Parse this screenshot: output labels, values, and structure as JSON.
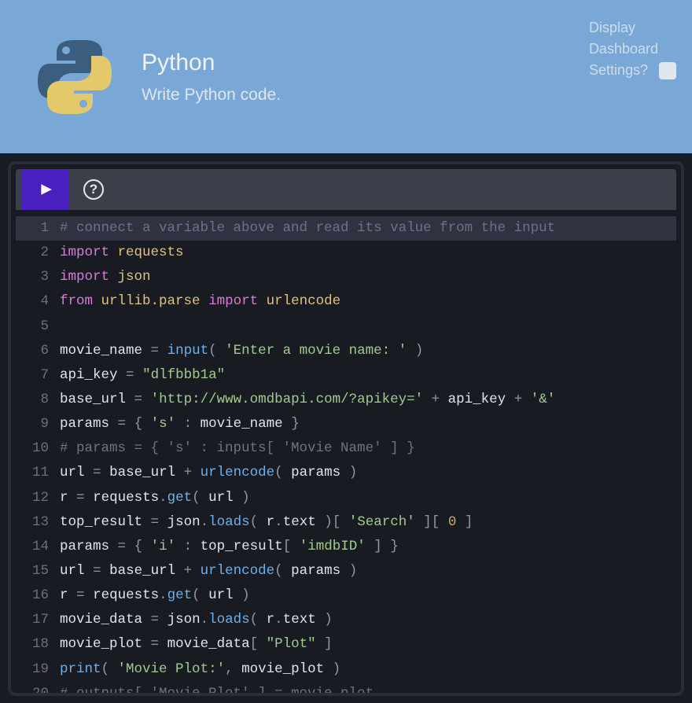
{
  "header": {
    "title": "Python",
    "subtitle": "Write Python code."
  },
  "settings": {
    "line1": "Display",
    "line2": "Dashboard",
    "line3": "Settings?"
  },
  "toolbar": {
    "run_label": "Run",
    "help_label": "?"
  },
  "code": {
    "lines": [
      {
        "n": 1,
        "highlight": true,
        "tokens": [
          {
            "t": "# connect a variable above and read its value from the input",
            "c": "comment"
          }
        ]
      },
      {
        "n": 2,
        "tokens": [
          {
            "t": "import",
            "c": "keyword"
          },
          {
            "t": " "
          },
          {
            "t": "requests",
            "c": "module"
          }
        ]
      },
      {
        "n": 3,
        "tokens": [
          {
            "t": "import",
            "c": "keyword"
          },
          {
            "t": " "
          },
          {
            "t": "json",
            "c": "module"
          }
        ]
      },
      {
        "n": 4,
        "tokens": [
          {
            "t": "from",
            "c": "keyword"
          },
          {
            "t": " "
          },
          {
            "t": "urllib.parse",
            "c": "module"
          },
          {
            "t": " "
          },
          {
            "t": "import",
            "c": "keyword"
          },
          {
            "t": " "
          },
          {
            "t": "urlencode",
            "c": "module"
          }
        ]
      },
      {
        "n": 5,
        "tokens": []
      },
      {
        "n": 6,
        "tokens": [
          {
            "t": "movie_name",
            "c": "var"
          },
          {
            "t": " "
          },
          {
            "t": "=",
            "c": "op"
          },
          {
            "t": " "
          },
          {
            "t": "input",
            "c": "builtin"
          },
          {
            "t": "(",
            "c": "punct"
          },
          {
            "t": " "
          },
          {
            "t": "'Enter a movie name: '",
            "c": "string"
          },
          {
            "t": " "
          },
          {
            "t": ")",
            "c": "punct"
          }
        ]
      },
      {
        "n": 7,
        "tokens": [
          {
            "t": "api_key",
            "c": "var"
          },
          {
            "t": " "
          },
          {
            "t": "=",
            "c": "op"
          },
          {
            "t": " "
          },
          {
            "t": "\"dlfbbb1a\"",
            "c": "string"
          }
        ]
      },
      {
        "n": 8,
        "tokens": [
          {
            "t": "base_url",
            "c": "var"
          },
          {
            "t": " "
          },
          {
            "t": "=",
            "c": "op"
          },
          {
            "t": " "
          },
          {
            "t": "'http://www.omdbapi.com/?apikey='",
            "c": "string"
          },
          {
            "t": " "
          },
          {
            "t": "+",
            "c": "op"
          },
          {
            "t": " "
          },
          {
            "t": "api_key",
            "c": "var"
          },
          {
            "t": " "
          },
          {
            "t": "+",
            "c": "op"
          },
          {
            "t": " "
          },
          {
            "t": "'&'",
            "c": "string"
          }
        ]
      },
      {
        "n": 9,
        "tokens": [
          {
            "t": "params",
            "c": "var"
          },
          {
            "t": " "
          },
          {
            "t": "=",
            "c": "op"
          },
          {
            "t": " "
          },
          {
            "t": "{",
            "c": "punct"
          },
          {
            "t": " "
          },
          {
            "t": "'s'",
            "c": "string"
          },
          {
            "t": " "
          },
          {
            "t": ":",
            "c": "punct"
          },
          {
            "t": " "
          },
          {
            "t": "movie_name",
            "c": "var"
          },
          {
            "t": " "
          },
          {
            "t": "}",
            "c": "punct"
          }
        ]
      },
      {
        "n": 10,
        "tokens": [
          {
            "t": "# params = { 's' : inputs[ 'Movie Name' ] }",
            "c": "comment"
          }
        ]
      },
      {
        "n": 11,
        "tokens": [
          {
            "t": "url",
            "c": "var"
          },
          {
            "t": " "
          },
          {
            "t": "=",
            "c": "op"
          },
          {
            "t": " "
          },
          {
            "t": "base_url",
            "c": "var"
          },
          {
            "t": " "
          },
          {
            "t": "+",
            "c": "op"
          },
          {
            "t": " "
          },
          {
            "t": "urlencode",
            "c": "func"
          },
          {
            "t": "(",
            "c": "punct"
          },
          {
            "t": " "
          },
          {
            "t": "params",
            "c": "var"
          },
          {
            "t": " "
          },
          {
            "t": ")",
            "c": "punct"
          }
        ]
      },
      {
        "n": 12,
        "tokens": [
          {
            "t": "r",
            "c": "var"
          },
          {
            "t": " "
          },
          {
            "t": "=",
            "c": "op"
          },
          {
            "t": " "
          },
          {
            "t": "requests",
            "c": "var"
          },
          {
            "t": ".",
            "c": "punct"
          },
          {
            "t": "get",
            "c": "func"
          },
          {
            "t": "(",
            "c": "punct"
          },
          {
            "t": " "
          },
          {
            "t": "url",
            "c": "var"
          },
          {
            "t": " "
          },
          {
            "t": ")",
            "c": "punct"
          }
        ]
      },
      {
        "n": 13,
        "tokens": [
          {
            "t": "top_result",
            "c": "var"
          },
          {
            "t": " "
          },
          {
            "t": "=",
            "c": "op"
          },
          {
            "t": " "
          },
          {
            "t": "json",
            "c": "var"
          },
          {
            "t": ".",
            "c": "punct"
          },
          {
            "t": "loads",
            "c": "func"
          },
          {
            "t": "(",
            "c": "punct"
          },
          {
            "t": " "
          },
          {
            "t": "r",
            "c": "var"
          },
          {
            "t": ".",
            "c": "punct"
          },
          {
            "t": "text",
            "c": "var"
          },
          {
            "t": " "
          },
          {
            "t": ")[",
            "c": "punct"
          },
          {
            "t": " "
          },
          {
            "t": "'Search'",
            "c": "string"
          },
          {
            "t": " "
          },
          {
            "t": "][",
            "c": "punct"
          },
          {
            "t": " "
          },
          {
            "t": "0",
            "c": "number"
          },
          {
            "t": " "
          },
          {
            "t": "]",
            "c": "punct"
          }
        ]
      },
      {
        "n": 14,
        "tokens": [
          {
            "t": "params",
            "c": "var"
          },
          {
            "t": " "
          },
          {
            "t": "=",
            "c": "op"
          },
          {
            "t": " "
          },
          {
            "t": "{",
            "c": "punct"
          },
          {
            "t": " "
          },
          {
            "t": "'i'",
            "c": "string"
          },
          {
            "t": " "
          },
          {
            "t": ":",
            "c": "punct"
          },
          {
            "t": " "
          },
          {
            "t": "top_result",
            "c": "var"
          },
          {
            "t": "[",
            "c": "punct"
          },
          {
            "t": " "
          },
          {
            "t": "'imdbID'",
            "c": "string"
          },
          {
            "t": " "
          },
          {
            "t": "]",
            "c": "punct"
          },
          {
            "t": " "
          },
          {
            "t": "}",
            "c": "punct"
          }
        ]
      },
      {
        "n": 15,
        "tokens": [
          {
            "t": "url",
            "c": "var"
          },
          {
            "t": " "
          },
          {
            "t": "=",
            "c": "op"
          },
          {
            "t": " "
          },
          {
            "t": "base_url",
            "c": "var"
          },
          {
            "t": " "
          },
          {
            "t": "+",
            "c": "op"
          },
          {
            "t": " "
          },
          {
            "t": "urlencode",
            "c": "func"
          },
          {
            "t": "(",
            "c": "punct"
          },
          {
            "t": " "
          },
          {
            "t": "params",
            "c": "var"
          },
          {
            "t": " "
          },
          {
            "t": ")",
            "c": "punct"
          }
        ]
      },
      {
        "n": 16,
        "tokens": [
          {
            "t": "r",
            "c": "var"
          },
          {
            "t": " "
          },
          {
            "t": "=",
            "c": "op"
          },
          {
            "t": " "
          },
          {
            "t": "requests",
            "c": "var"
          },
          {
            "t": ".",
            "c": "punct"
          },
          {
            "t": "get",
            "c": "func"
          },
          {
            "t": "(",
            "c": "punct"
          },
          {
            "t": " "
          },
          {
            "t": "url",
            "c": "var"
          },
          {
            "t": " "
          },
          {
            "t": ")",
            "c": "punct"
          }
        ]
      },
      {
        "n": 17,
        "tokens": [
          {
            "t": "movie_data",
            "c": "var"
          },
          {
            "t": " "
          },
          {
            "t": "=",
            "c": "op"
          },
          {
            "t": " "
          },
          {
            "t": "json",
            "c": "var"
          },
          {
            "t": ".",
            "c": "punct"
          },
          {
            "t": "loads",
            "c": "func"
          },
          {
            "t": "(",
            "c": "punct"
          },
          {
            "t": " "
          },
          {
            "t": "r",
            "c": "var"
          },
          {
            "t": ".",
            "c": "punct"
          },
          {
            "t": "text",
            "c": "var"
          },
          {
            "t": " "
          },
          {
            "t": ")",
            "c": "punct"
          }
        ]
      },
      {
        "n": 18,
        "tokens": [
          {
            "t": "movie_plot",
            "c": "var"
          },
          {
            "t": " "
          },
          {
            "t": "=",
            "c": "op"
          },
          {
            "t": " "
          },
          {
            "t": "movie_data",
            "c": "var"
          },
          {
            "t": "[",
            "c": "punct"
          },
          {
            "t": " "
          },
          {
            "t": "\"Plot\"",
            "c": "string"
          },
          {
            "t": " "
          },
          {
            "t": "]",
            "c": "punct"
          }
        ]
      },
      {
        "n": 19,
        "tokens": [
          {
            "t": "print",
            "c": "builtin"
          },
          {
            "t": "(",
            "c": "punct"
          },
          {
            "t": " "
          },
          {
            "t": "'Movie Plot:'",
            "c": "string"
          },
          {
            "t": ",",
            "c": "punct"
          },
          {
            "t": " "
          },
          {
            "t": "movie_plot",
            "c": "var"
          },
          {
            "t": " "
          },
          {
            "t": ")",
            "c": "punct"
          }
        ]
      },
      {
        "n": 20,
        "tokens": [
          {
            "t": "# outputs[ 'Movie Plot' ] = movie plot",
            "c": "comment"
          }
        ]
      }
    ]
  }
}
